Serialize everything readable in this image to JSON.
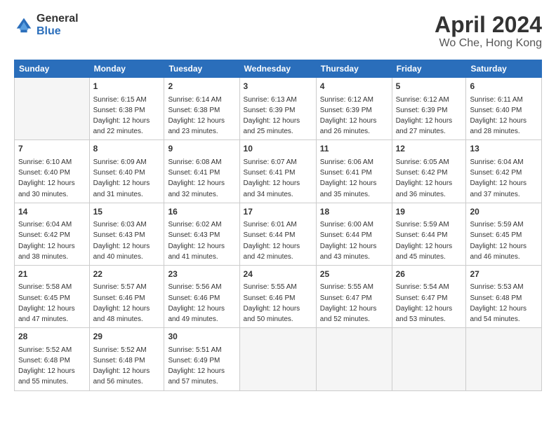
{
  "header": {
    "logo_general": "General",
    "logo_blue": "Blue",
    "title": "April 2024",
    "location": "Wo Che, Hong Kong"
  },
  "weekdays": [
    "Sunday",
    "Monday",
    "Tuesday",
    "Wednesday",
    "Thursday",
    "Friday",
    "Saturday"
  ],
  "weeks": [
    [
      {
        "day": "",
        "sunrise": "",
        "sunset": "",
        "daylight": "",
        "empty": true
      },
      {
        "day": "1",
        "sunrise": "Sunrise: 6:15 AM",
        "sunset": "Sunset: 6:38 PM",
        "daylight": "Daylight: 12 hours and 22 minutes.",
        "empty": false
      },
      {
        "day": "2",
        "sunrise": "Sunrise: 6:14 AM",
        "sunset": "Sunset: 6:38 PM",
        "daylight": "Daylight: 12 hours and 23 minutes.",
        "empty": false
      },
      {
        "day": "3",
        "sunrise": "Sunrise: 6:13 AM",
        "sunset": "Sunset: 6:39 PM",
        "daylight": "Daylight: 12 hours and 25 minutes.",
        "empty": false
      },
      {
        "day": "4",
        "sunrise": "Sunrise: 6:12 AM",
        "sunset": "Sunset: 6:39 PM",
        "daylight": "Daylight: 12 hours and 26 minutes.",
        "empty": false
      },
      {
        "day": "5",
        "sunrise": "Sunrise: 6:12 AM",
        "sunset": "Sunset: 6:39 PM",
        "daylight": "Daylight: 12 hours and 27 minutes.",
        "empty": false
      },
      {
        "day": "6",
        "sunrise": "Sunrise: 6:11 AM",
        "sunset": "Sunset: 6:40 PM",
        "daylight": "Daylight: 12 hours and 28 minutes.",
        "empty": false
      }
    ],
    [
      {
        "day": "7",
        "sunrise": "Sunrise: 6:10 AM",
        "sunset": "Sunset: 6:40 PM",
        "daylight": "Daylight: 12 hours and 30 minutes.",
        "empty": false
      },
      {
        "day": "8",
        "sunrise": "Sunrise: 6:09 AM",
        "sunset": "Sunset: 6:40 PM",
        "daylight": "Daylight: 12 hours and 31 minutes.",
        "empty": false
      },
      {
        "day": "9",
        "sunrise": "Sunrise: 6:08 AM",
        "sunset": "Sunset: 6:41 PM",
        "daylight": "Daylight: 12 hours and 32 minutes.",
        "empty": false
      },
      {
        "day": "10",
        "sunrise": "Sunrise: 6:07 AM",
        "sunset": "Sunset: 6:41 PM",
        "daylight": "Daylight: 12 hours and 34 minutes.",
        "empty": false
      },
      {
        "day": "11",
        "sunrise": "Sunrise: 6:06 AM",
        "sunset": "Sunset: 6:41 PM",
        "daylight": "Daylight: 12 hours and 35 minutes.",
        "empty": false
      },
      {
        "day": "12",
        "sunrise": "Sunrise: 6:05 AM",
        "sunset": "Sunset: 6:42 PM",
        "daylight": "Daylight: 12 hours and 36 minutes.",
        "empty": false
      },
      {
        "day": "13",
        "sunrise": "Sunrise: 6:04 AM",
        "sunset": "Sunset: 6:42 PM",
        "daylight": "Daylight: 12 hours and 37 minutes.",
        "empty": false
      }
    ],
    [
      {
        "day": "14",
        "sunrise": "Sunrise: 6:04 AM",
        "sunset": "Sunset: 6:42 PM",
        "daylight": "Daylight: 12 hours and 38 minutes.",
        "empty": false
      },
      {
        "day": "15",
        "sunrise": "Sunrise: 6:03 AM",
        "sunset": "Sunset: 6:43 PM",
        "daylight": "Daylight: 12 hours and 40 minutes.",
        "empty": false
      },
      {
        "day": "16",
        "sunrise": "Sunrise: 6:02 AM",
        "sunset": "Sunset: 6:43 PM",
        "daylight": "Daylight: 12 hours and 41 minutes.",
        "empty": false
      },
      {
        "day": "17",
        "sunrise": "Sunrise: 6:01 AM",
        "sunset": "Sunset: 6:44 PM",
        "daylight": "Daylight: 12 hours and 42 minutes.",
        "empty": false
      },
      {
        "day": "18",
        "sunrise": "Sunrise: 6:00 AM",
        "sunset": "Sunset: 6:44 PM",
        "daylight": "Daylight: 12 hours and 43 minutes.",
        "empty": false
      },
      {
        "day": "19",
        "sunrise": "Sunrise: 5:59 AM",
        "sunset": "Sunset: 6:44 PM",
        "daylight": "Daylight: 12 hours and 45 minutes.",
        "empty": false
      },
      {
        "day": "20",
        "sunrise": "Sunrise: 5:59 AM",
        "sunset": "Sunset: 6:45 PM",
        "daylight": "Daylight: 12 hours and 46 minutes.",
        "empty": false
      }
    ],
    [
      {
        "day": "21",
        "sunrise": "Sunrise: 5:58 AM",
        "sunset": "Sunset: 6:45 PM",
        "daylight": "Daylight: 12 hours and 47 minutes.",
        "empty": false
      },
      {
        "day": "22",
        "sunrise": "Sunrise: 5:57 AM",
        "sunset": "Sunset: 6:46 PM",
        "daylight": "Daylight: 12 hours and 48 minutes.",
        "empty": false
      },
      {
        "day": "23",
        "sunrise": "Sunrise: 5:56 AM",
        "sunset": "Sunset: 6:46 PM",
        "daylight": "Daylight: 12 hours and 49 minutes.",
        "empty": false
      },
      {
        "day": "24",
        "sunrise": "Sunrise: 5:55 AM",
        "sunset": "Sunset: 6:46 PM",
        "daylight": "Daylight: 12 hours and 50 minutes.",
        "empty": false
      },
      {
        "day": "25",
        "sunrise": "Sunrise: 5:55 AM",
        "sunset": "Sunset: 6:47 PM",
        "daylight": "Daylight: 12 hours and 52 minutes.",
        "empty": false
      },
      {
        "day": "26",
        "sunrise": "Sunrise: 5:54 AM",
        "sunset": "Sunset: 6:47 PM",
        "daylight": "Daylight: 12 hours and 53 minutes.",
        "empty": false
      },
      {
        "day": "27",
        "sunrise": "Sunrise: 5:53 AM",
        "sunset": "Sunset: 6:48 PM",
        "daylight": "Daylight: 12 hours and 54 minutes.",
        "empty": false
      }
    ],
    [
      {
        "day": "28",
        "sunrise": "Sunrise: 5:52 AM",
        "sunset": "Sunset: 6:48 PM",
        "daylight": "Daylight: 12 hours and 55 minutes.",
        "empty": false
      },
      {
        "day": "29",
        "sunrise": "Sunrise: 5:52 AM",
        "sunset": "Sunset: 6:48 PM",
        "daylight": "Daylight: 12 hours and 56 minutes.",
        "empty": false
      },
      {
        "day": "30",
        "sunrise": "Sunrise: 5:51 AM",
        "sunset": "Sunset: 6:49 PM",
        "daylight": "Daylight: 12 hours and 57 minutes.",
        "empty": false
      },
      {
        "day": "",
        "sunrise": "",
        "sunset": "",
        "daylight": "",
        "empty": true
      },
      {
        "day": "",
        "sunrise": "",
        "sunset": "",
        "daylight": "",
        "empty": true
      },
      {
        "day": "",
        "sunrise": "",
        "sunset": "",
        "daylight": "",
        "empty": true
      },
      {
        "day": "",
        "sunrise": "",
        "sunset": "",
        "daylight": "",
        "empty": true
      }
    ]
  ]
}
